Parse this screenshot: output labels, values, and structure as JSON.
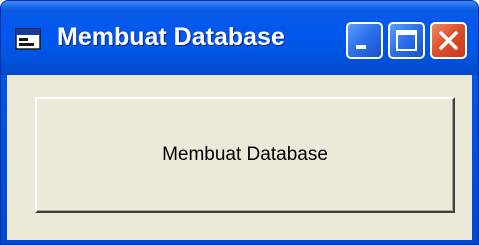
{
  "window": {
    "title": "Membuat Database",
    "controls": {
      "minimize_icon": "minimize-icon",
      "maximize_icon": "maximize-icon",
      "close_icon": "close-icon"
    }
  },
  "form": {
    "button_label": "Membuat Database"
  },
  "colors": {
    "titlebar": "#0054e3",
    "close_button": "#e0502a",
    "client_background": "#ece9d8"
  }
}
